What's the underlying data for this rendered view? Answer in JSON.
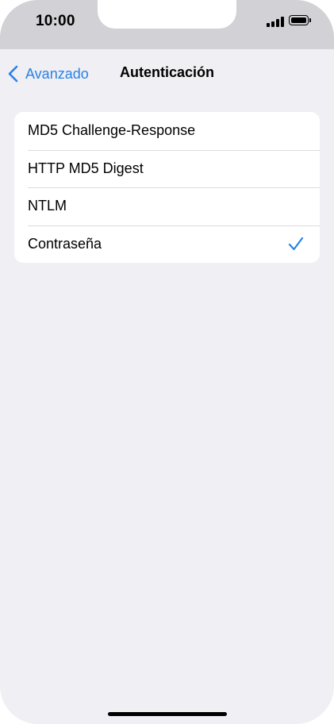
{
  "status_bar": {
    "time": "10:00"
  },
  "nav": {
    "back_label": "Avanzado",
    "title": "Autenticación"
  },
  "options": [
    {
      "label": "MD5 Challenge-Response",
      "selected": false
    },
    {
      "label": "HTTP MD5 Digest",
      "selected": false
    },
    {
      "label": "NTLM",
      "selected": false
    },
    {
      "label": "Contraseña",
      "selected": true
    }
  ],
  "colors": {
    "accent": "#2a82e4",
    "background": "#efeff4",
    "status_bar_background": "#d1d1d6"
  },
  "icons": {
    "back": "chevron-left-icon",
    "selected": "checkmark-icon"
  }
}
